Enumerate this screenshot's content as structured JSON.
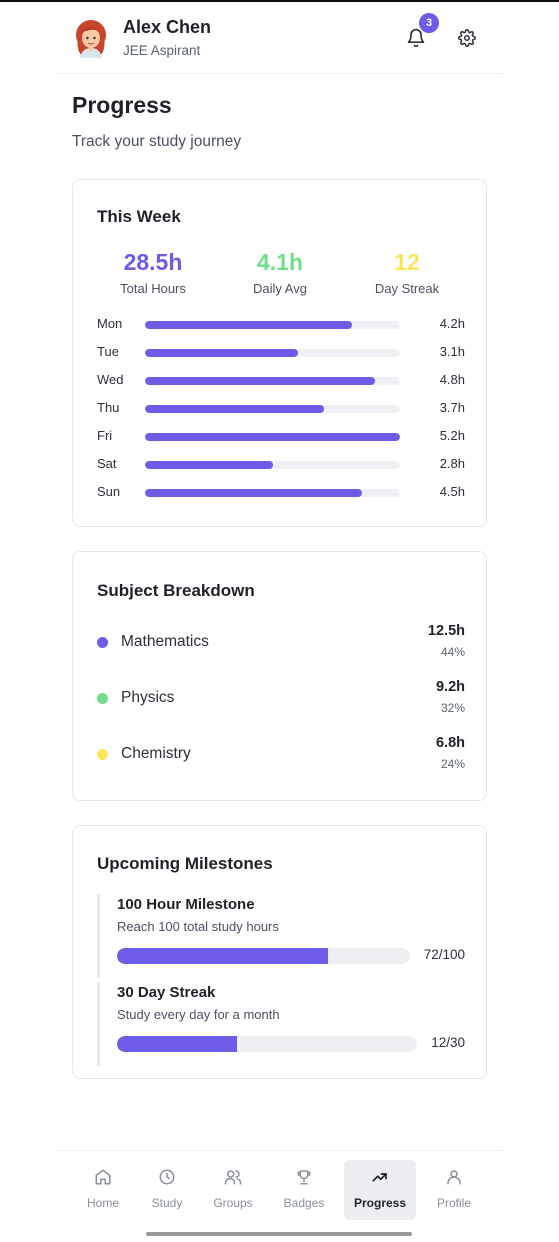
{
  "user": {
    "name": "Alex Chen",
    "role": "JEE Aspirant",
    "notifications": "3"
  },
  "page": {
    "title": "Progress",
    "subtitle": "Track your study journey"
  },
  "week": {
    "title": "This Week",
    "stats": [
      {
        "value": "28.5h",
        "label": "Total Hours",
        "color": "#6c5ce7"
      },
      {
        "value": "4.1h",
        "label": "Daily Avg",
        "color": "#72de8b"
      },
      {
        "value": "12",
        "label": "Day Streak",
        "color": "#fbe55c"
      }
    ],
    "days": [
      {
        "day": "Mon",
        "hours": "4.2h",
        "fraction": 0.81
      },
      {
        "day": "Tue",
        "hours": "3.1h",
        "fraction": 0.6
      },
      {
        "day": "Wed",
        "hours": "4.8h",
        "fraction": 0.9
      },
      {
        "day": "Thu",
        "hours": "3.7h",
        "fraction": 0.7
      },
      {
        "day": "Fri",
        "hours": "5.2h",
        "fraction": 1.0
      },
      {
        "day": "Sat",
        "hours": "2.8h",
        "fraction": 0.5
      },
      {
        "day": "Sun",
        "hours": "4.5h",
        "fraction": 0.85
      }
    ]
  },
  "subjects": {
    "title": "Subject Breakdown",
    "items": [
      {
        "name": "Mathematics",
        "hours": "12.5h",
        "percent": "44%",
        "color": "#6c5ce7"
      },
      {
        "name": "Physics",
        "hours": "9.2h",
        "percent": "32%",
        "color": "#72de8b"
      },
      {
        "name": "Chemistry",
        "hours": "6.8h",
        "percent": "24%",
        "color": "#fbe55c"
      }
    ]
  },
  "milestones": {
    "title": "Upcoming Milestones",
    "items": [
      {
        "title": "100 Hour Milestone",
        "desc": "Reach 100 total study hours",
        "progress": "72/100",
        "fraction": 0.72
      },
      {
        "title": "30 Day Streak",
        "desc": "Study every day for a month",
        "progress": "12/30",
        "fraction": 0.4
      }
    ]
  },
  "nav": {
    "items": [
      {
        "label": "Home",
        "icon": "home-icon"
      },
      {
        "label": "Study",
        "icon": "clock-icon"
      },
      {
        "label": "Groups",
        "icon": "users-icon"
      },
      {
        "label": "Badges",
        "icon": "trophy-icon"
      },
      {
        "label": "Progress",
        "icon": "trending-up-icon",
        "active": true
      },
      {
        "label": "Profile",
        "icon": "user-icon"
      }
    ]
  }
}
